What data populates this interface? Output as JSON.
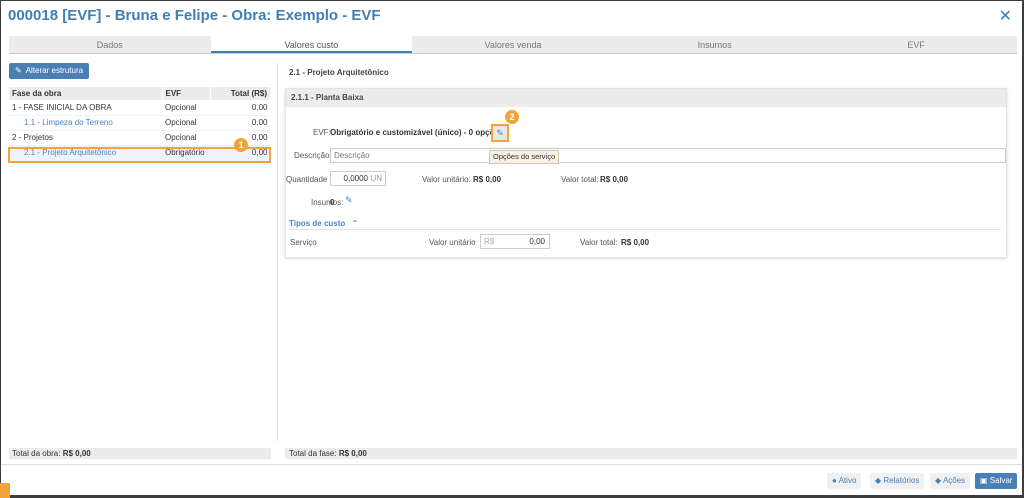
{
  "window": {
    "title": "000018 [EVF] - Bruna e Felipe - Obra: Exemplo - EVF",
    "close_glyph": "✕"
  },
  "tabs": [
    {
      "label": "Dados",
      "active": false
    },
    {
      "label": "Valores custo",
      "active": true
    },
    {
      "label": "Valores venda",
      "active": false
    },
    {
      "label": "Insumos",
      "active": false
    },
    {
      "label": "EVF",
      "active": false
    }
  ],
  "left": {
    "alter_button": "Alterar estrutura",
    "columns": [
      "Fase da obra",
      "EVF",
      "Total (R$)"
    ],
    "rows": [
      {
        "fase": "1 - FASE INICIAL DA OBRA",
        "evf": "Opcional",
        "total": "0,00"
      },
      {
        "fase": "1.1 - Limpeza do Terreno",
        "evf": "Opcional",
        "total": "0,00"
      },
      {
        "fase": "2 - Projetos",
        "evf": "Opcional",
        "total": "0,00"
      },
      {
        "fase": "2.1 - Projeto Arquitetônico",
        "evf": "Obrigatório",
        "total": "0,00"
      }
    ],
    "total_label": "Total da obra:",
    "total_value": "R$ 0,00"
  },
  "right": {
    "section_title": "2.1 - Projeto Arquitetônico",
    "card_title": "2.1.1 - Planta Baixa",
    "evf_label": "EVF:",
    "evf_value": "Obrigatório e customizável (único) - 0 opções",
    "tooltip": "Opções do serviço",
    "descricao_label": "Descrição",
    "descricao_placeholder": "Descrição",
    "quantidade_label": "Quantidade",
    "quantidade_value": "0,0000",
    "unit": "UN",
    "valor_unitario_label": "Valor unitário:",
    "valor_unitario_value": "R$ 0,00",
    "valor_total_label": "Valor total:",
    "valor_total_value": "R$ 0,00",
    "insumos_label": "Insumos:",
    "insumos_value": "0",
    "tipos_label": "Tipos de custo",
    "servico_label": "Serviço",
    "servico_vu_label": "Valor unitário",
    "servico_currency": "R$",
    "servico_vu_value": "0,00",
    "servico_vt_label": "Valor total:",
    "servico_vt_value": "R$ 0,00",
    "total_fase_label": "Total da fase:",
    "total_fase_value": "R$ 0,00"
  },
  "badges": {
    "one": "1",
    "two": "2"
  },
  "footer": {
    "ativo": "Ativo",
    "relatorios": "Relatórios",
    "acoes": "Ações",
    "salvar": "Salvar"
  },
  "icons": {
    "pencil": "pencil-icon",
    "close": "close-icon",
    "chevron_up": "chevron-up-icon",
    "save": "save-icon"
  },
  "colors": {
    "accent": "#3f7fb5",
    "highlight": "#f2a33a"
  }
}
